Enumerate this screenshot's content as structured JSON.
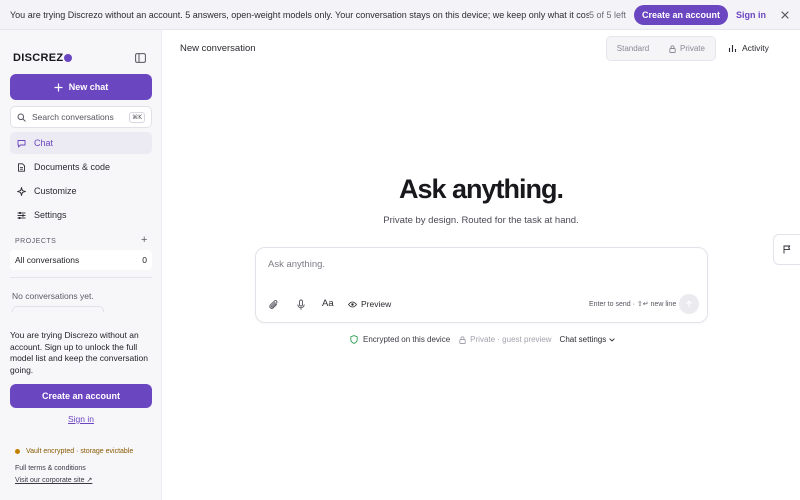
{
  "banner": {
    "text": "You are trying Discrezo without an account. 5 answers, open-weight models only. Your conversation stays on this device; we keep only what it cost.",
    "count": "5 of 5 left",
    "create_label": "Create an account",
    "signin_label": "Sign in",
    "close_icon": "close-icon"
  },
  "sidebar": {
    "logo": "DISCREZ",
    "new_chat_label": "New chat",
    "search_placeholder": "Search conversations",
    "search_shortcut": "⌘K",
    "nav": [
      {
        "label": "Chat",
        "icon": "chat-bubble-icon",
        "active": true
      },
      {
        "label": "Documents & code",
        "icon": "document-icon",
        "active": false
      },
      {
        "label": "Customize",
        "icon": "sparkle-icon",
        "active": false
      },
      {
        "label": "Settings",
        "icon": "sliders-icon",
        "active": false
      }
    ],
    "projects_label": "PROJECTS",
    "projects_add": "+",
    "all_conversations": {
      "label": "All conversations",
      "count": "0"
    },
    "empty_text": "No conversations yet.",
    "trial_text": "You are trying Discrezo without an account. Sign up to unlock the full model list and keep the conversation going.",
    "create_label": "Create an account",
    "signin_label": "Sign in",
    "vault_status": "Vault encrypted · storage evictable",
    "terms_label": "Full terms & conditions",
    "corporate_label": "Visit our corporate site ↗"
  },
  "header": {
    "title": "New conversation",
    "mode_standard": "Standard",
    "mode_private": "Private",
    "activity_label": "Activity"
  },
  "hero": {
    "title": "Ask anything.",
    "subtitle": "Private by design. Routed for the task at hand."
  },
  "composer": {
    "placeholder": "Ask anything.",
    "font_label": "Aa",
    "preview_label": "Preview",
    "hint": "Enter to send · ⇧↵ new line"
  },
  "meta": {
    "encrypted": "Encrypted on this device",
    "private_preview": "Private · guest preview",
    "chat_settings": "Chat settings"
  },
  "colors": {
    "accent": "#6b46c1",
    "sidebar_bg": "#f7f7fa",
    "banner_bg": "#f4f3f8",
    "vault_text": "#8a5a00"
  }
}
